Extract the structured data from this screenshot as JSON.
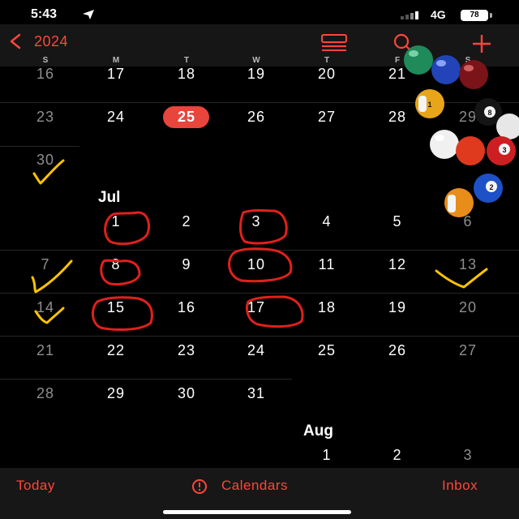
{
  "status_bar": {
    "time": "5:43",
    "network": "4G",
    "battery": "78"
  },
  "header": {
    "year": "2024"
  },
  "weekdays": [
    "S",
    "M",
    "T",
    "W",
    "T",
    "F",
    "S"
  ],
  "june": {
    "rows": [
      [
        "16",
        "17",
        "18",
        "19",
        "20",
        "21",
        "22"
      ],
      [
        "23",
        "24",
        "25",
        "26",
        "27",
        "28",
        "29"
      ],
      [
        "30"
      ]
    ],
    "selected_day": "25"
  },
  "july": {
    "label": "Jul",
    "rows": [
      [
        "1",
        "2",
        "3",
        "4",
        "5",
        "6"
      ],
      [
        "7",
        "8",
        "9",
        "10",
        "11",
        "12",
        "13"
      ],
      [
        "14",
        "15",
        "16",
        "17",
        "18",
        "19",
        "20"
      ],
      [
        "21",
        "22",
        "23",
        "24",
        "25",
        "26",
        "27"
      ],
      [
        "28",
        "29",
        "30",
        "31"
      ]
    ]
  },
  "august": {
    "label": "Aug",
    "rows": [
      [
        "1",
        "2",
        "3"
      ]
    ]
  },
  "tab_bar": {
    "today": "Today",
    "calendars": "Calendars",
    "inbox": "Inbox"
  },
  "billiard_balls": [
    "1",
    "8",
    "3",
    "2"
  ],
  "colors": {
    "accent": "#ff453a",
    "today_circle": "#e8453c",
    "annotation_red": "#e0201c",
    "annotation_yellow": "#ffc400"
  }
}
